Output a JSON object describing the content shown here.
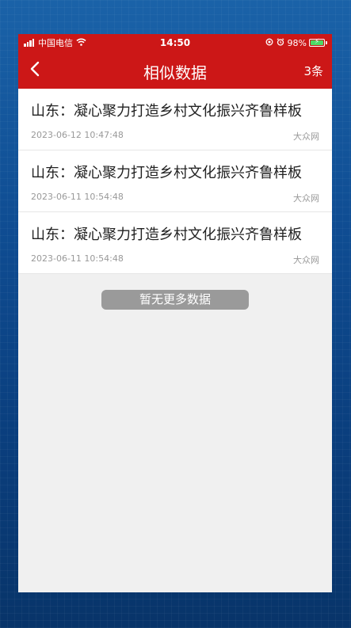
{
  "status_bar": {
    "carrier": "中国电信",
    "time": "14:50",
    "battery": "98%",
    "battery_level": 0.98,
    "icons": [
      "signal-icon",
      "wifi-icon",
      "rotation-lock-icon",
      "alarm-icon",
      "battery-icon"
    ]
  },
  "nav": {
    "title": "相似数据",
    "count": "3条",
    "back_icon": "back-chevron-icon"
  },
  "items": [
    {
      "title": "山东：凝心聚力打造乡村文化振兴齐鲁样板",
      "date": "2023-06-12 10:47:48",
      "source": "大众网"
    },
    {
      "title": "山东：凝心聚力打造乡村文化振兴齐鲁样板",
      "date": "2023-06-11 10:54:48",
      "source": "大众网"
    },
    {
      "title": "山东：凝心聚力打造乡村文化振兴齐鲁样板",
      "date": "2023-06-11 10:54:48",
      "source": "大众网"
    }
  ],
  "footer": {
    "no_more": "暂无更多数据"
  },
  "colors": {
    "header": "#cc1717",
    "background": "#0c3d78",
    "page": "#f0f0f0"
  }
}
